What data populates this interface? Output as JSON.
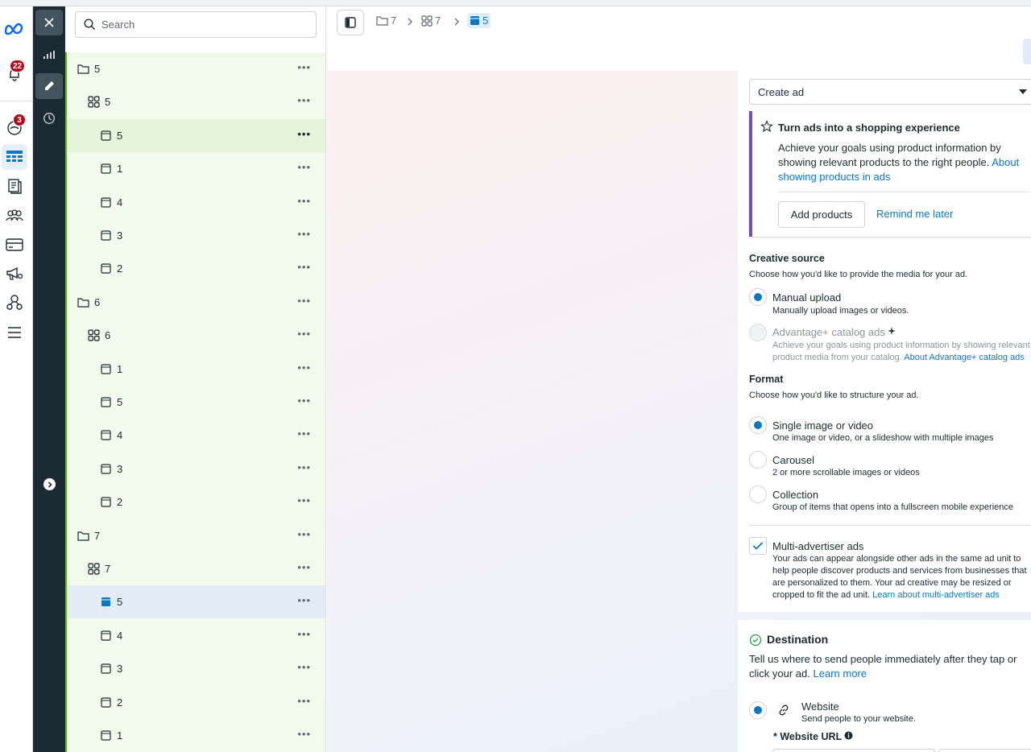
{
  "global_nav": {
    "notifications_badge": "22",
    "updates_badge": "3"
  },
  "tree": {
    "search_placeholder": "Search",
    "rows": [
      {
        "type": "campaign",
        "label": "5",
        "level": 0
      },
      {
        "type": "adset",
        "label": "5",
        "level": 1
      },
      {
        "type": "ad",
        "label": "5",
        "level": 2,
        "state": "hover"
      },
      {
        "type": "ad",
        "label": "1",
        "level": 2
      },
      {
        "type": "ad",
        "label": "4",
        "level": 2
      },
      {
        "type": "ad",
        "label": "3",
        "level": 2
      },
      {
        "type": "ad",
        "label": "2",
        "level": 2
      },
      {
        "type": "campaign",
        "label": "6",
        "level": 0
      },
      {
        "type": "adset",
        "label": "6",
        "level": 1
      },
      {
        "type": "ad",
        "label": "1",
        "level": 2
      },
      {
        "type": "ad",
        "label": "5",
        "level": 2
      },
      {
        "type": "ad",
        "label": "4",
        "level": 2
      },
      {
        "type": "ad",
        "label": "3",
        "level": 2
      },
      {
        "type": "ad",
        "label": "2",
        "level": 2
      },
      {
        "type": "campaign",
        "label": "7",
        "level": 0
      },
      {
        "type": "adset",
        "label": "7",
        "level": 1
      },
      {
        "type": "ad",
        "label": "5",
        "level": 2,
        "state": "selected"
      },
      {
        "type": "ad",
        "label": "4",
        "level": 2
      },
      {
        "type": "ad",
        "label": "3",
        "level": 2
      },
      {
        "type": "ad",
        "label": "2",
        "level": 2
      },
      {
        "type": "ad",
        "label": "1",
        "level": 2
      }
    ],
    "more_glyph": "•••"
  },
  "breadcrumb": {
    "campaign": "7",
    "adset": "7",
    "ad": "5"
  },
  "editor": {
    "select_value": "Create ad",
    "promo": {
      "title": "Turn ads into a shopping experience",
      "body": "Achieve your goals using product information by showing relevant products to the right people.",
      "link": "About showing products in ads",
      "primary_button": "Add products",
      "secondary_link": "Remind me later"
    },
    "creative_source": {
      "title": "Creative source",
      "subtitle": "Choose how you'd like to provide the media for your ad.",
      "options": [
        {
          "title": "Manual upload",
          "desc": "Manually upload images or videos.",
          "selected": true
        },
        {
          "title": "Advantage+ catalog ads",
          "desc_line1": "Achieve your goals using product information by showing relevant",
          "desc_line2": "product media from your catalog.",
          "link": "About Advantage+ catalog ads",
          "disabled": true
        }
      ]
    },
    "format": {
      "title": "Format",
      "subtitle": "Choose how you'd like to structure your ad.",
      "options": [
        {
          "title": "Single image or video",
          "desc": "One image or video, or a slideshow with multiple images",
          "selected": true
        },
        {
          "title": "Carousel",
          "desc": "2 or more scrollable images or videos"
        },
        {
          "title": "Collection",
          "desc": "Group of items that opens into a fullscreen mobile experience"
        }
      ]
    },
    "multi_advertiser": {
      "title": "Multi-advertiser ads",
      "desc": "Your ads can appear alongside other ads in the same ad unit to help people discover products and services from businesses that are personalized to them. Your ad creative may be resized or cropped to fit the ad unit.",
      "link": "Learn about multi-advertiser ads",
      "checked": true
    },
    "destination": {
      "title": "Destination",
      "body": "Tell us where to send people immediately after they tap or click your ad.",
      "link": "Learn more",
      "option_title": "Website",
      "option_desc": "Send people to your website.",
      "url_label": "* Website URL"
    }
  },
  "colors": {
    "accent": "#0a78be",
    "tree_bg": "#f2faec",
    "tree_border": "#63be09",
    "rail": "#1c2b33",
    "promo_border": "#6e52b8",
    "badge": "#b0091b"
  }
}
